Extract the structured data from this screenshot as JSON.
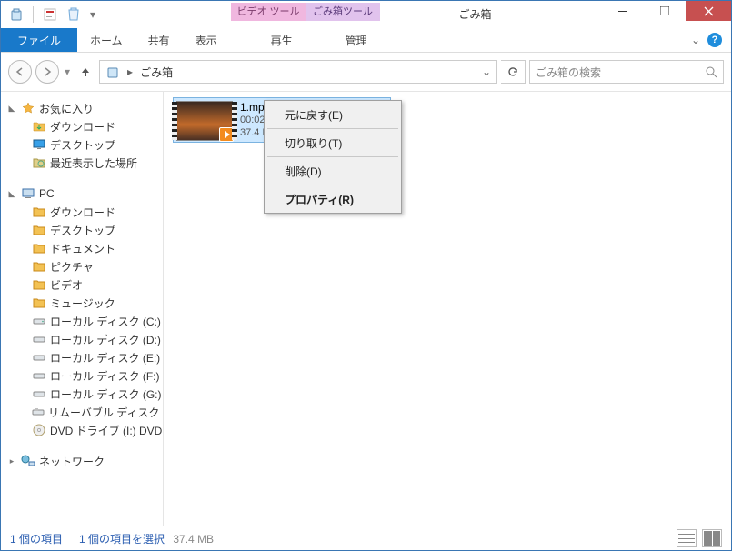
{
  "titlebar": {
    "title": "ごみ箱",
    "ctx_video": "ビデオ ツール",
    "ctx_bin": "ごみ箱ツール"
  },
  "ribbon": {
    "file": "ファイル",
    "tabs": [
      "ホーム",
      "共有",
      "表示"
    ],
    "ctx_tabs": [
      "再生",
      "管理"
    ]
  },
  "nav": {
    "crumb": "ごみ箱",
    "search_placeholder": "ごみ箱の検索"
  },
  "sidebar": {
    "favorites": {
      "label": "お気に入り",
      "items": [
        "ダウンロード",
        "デスクトップ",
        "最近表示した場所"
      ]
    },
    "pc": {
      "label": "PC",
      "items": [
        "ダウンロード",
        "デスクトップ",
        "ドキュメント",
        "ピクチャ",
        "ビデオ",
        "ミュージック",
        "ローカル ディスク (C:)",
        "ローカル ディスク (D:)",
        "ローカル ディスク (E:)",
        "ローカル ディスク (F:)",
        "ローカル ディスク (G:)",
        "リムーバブル ディスク (H:)",
        "DVD ドライブ (I:) DVD"
      ]
    },
    "network": {
      "label": "ネットワーク"
    }
  },
  "file": {
    "name": "1.mp4",
    "line2": "00:02",
    "line3": "37.4 MB"
  },
  "context_menu": {
    "restore": "元に戻す(E)",
    "cut": "切り取り(T)",
    "delete": "削除(D)",
    "properties": "プロパティ(R)"
  },
  "status": {
    "count": "1 個の項目",
    "selection": "1 個の項目を選択",
    "size": "37.4 MB"
  },
  "icons": {
    "bin_color": "#6fa8d8",
    "star_color": "#f5b642",
    "pc_color": "#3a6fa8",
    "drive_color": "#8a8a8a",
    "dvd_color": "#b0a070",
    "network_color": "#2a7a9a",
    "folder_color": "#f3c254"
  }
}
